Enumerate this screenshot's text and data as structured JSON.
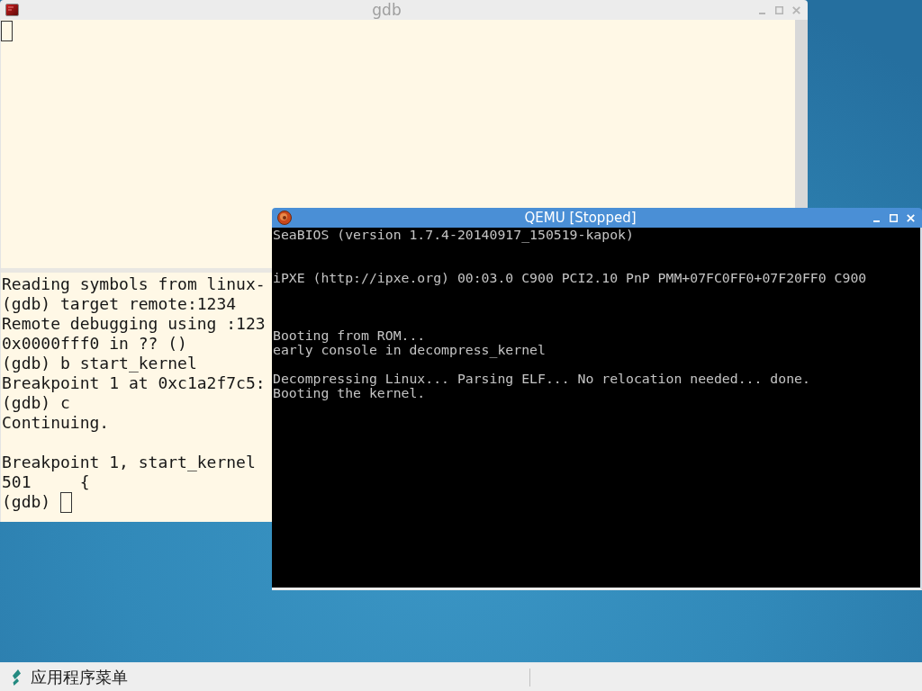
{
  "windows": [
    {
      "kind": "terminal",
      "title": "gdb",
      "active": false,
      "lines": [
        "Reading symbols from linux-",
        "(gdb) target remote:1234",
        "Remote debugging using :123",
        "0x0000fff0 in ?? ()",
        "(gdb) b start_kernel",
        "Breakpoint 1 at 0xc1a2f7c5:",
        "(gdb) c",
        "Continuing.",
        "Breakpoint 1, start_kernel",
        "501     {",
        "(gdb)"
      ]
    },
    {
      "kind": "emulator",
      "title": "QEMU [Stopped]",
      "active": true,
      "lines": [
        "SeaBIOS (version 1.7.4-20140917_150519-kapok)",
        "iPXE (http://ipxe.org) 00:03.0 C900 PCI2.10 PnP PMM+07FC0FF0+07F20FF0 C900",
        "Booting from ROM...",
        "early console in decompress_kernel",
        "Decompressing Linux... Parsing ELF... No relocation needed... done.",
        "Booting the kernel."
      ]
    }
  ],
  "taskbar": {
    "menu_button": "应用程序菜单"
  }
}
